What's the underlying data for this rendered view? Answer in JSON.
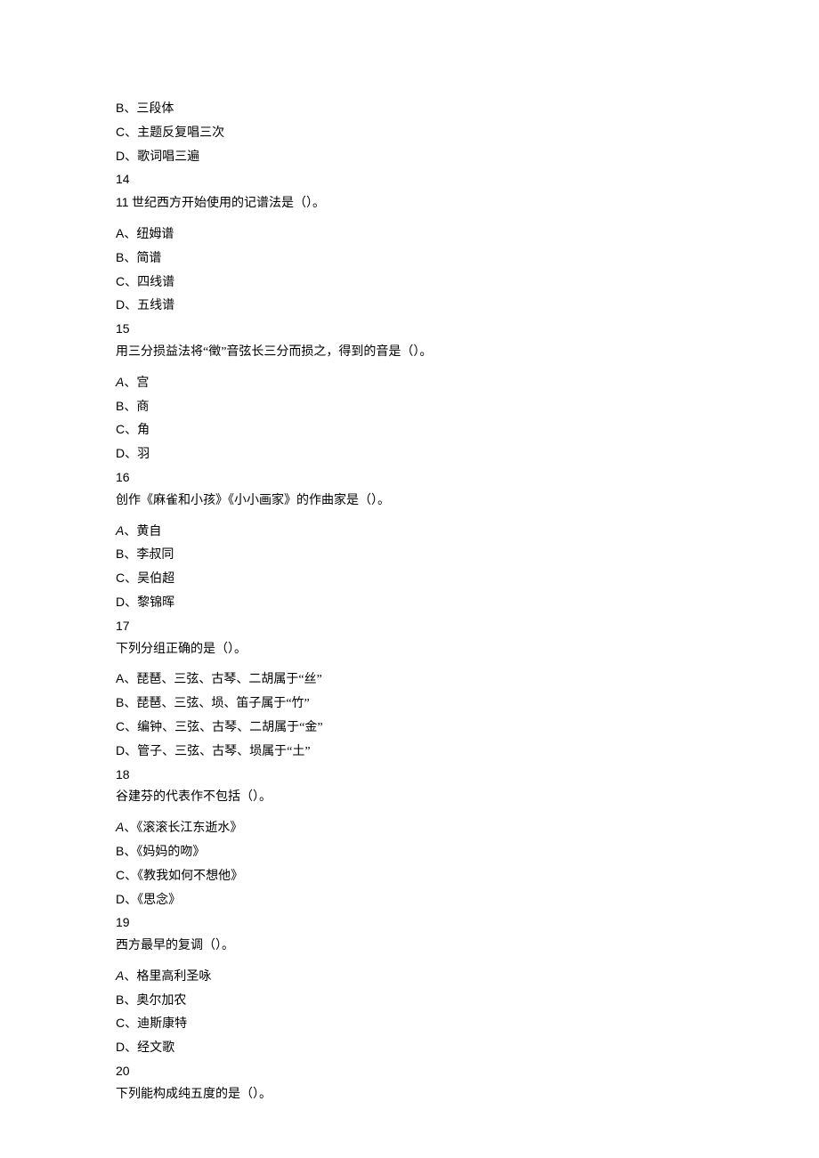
{
  "pre_options": [
    "B、三段体",
    "C、主题反复唱三次",
    "D、歌词唱三遍"
  ],
  "questions": [
    {
      "number": "14",
      "stem_prefix_latin": "11",
      "stem": "世纪西方开始使用的记谱法是（）。",
      "options": [
        {
          "label": "A",
          "text": "纽姆谱",
          "latin_label": true
        },
        {
          "label": "B",
          "text": "简谱",
          "latin_label": true
        },
        {
          "label": "C",
          "text": "四线谱",
          "latin_label": true
        },
        {
          "label": "D",
          "text": "五线谱",
          "latin_label": true
        }
      ]
    },
    {
      "number": "15",
      "stem": "用三分损益法将“徵”音弦长三分而损之，得到的音是（）。",
      "options": [
        {
          "label": "A",
          "text": "宫",
          "latin_label": true,
          "italic": true
        },
        {
          "label": "B",
          "text": "商",
          "latin_label": true
        },
        {
          "label": "C",
          "text": "角",
          "latin_label": true
        },
        {
          "label": "D",
          "text": "羽",
          "latin_label": true
        }
      ]
    },
    {
      "number": "16",
      "stem": "创作《麻雀和小孩》《小小画家》的作曲家是（）。",
      "options": [
        {
          "label": "A",
          "text": "黄自",
          "latin_label": true,
          "italic": true
        },
        {
          "label": "B",
          "text": "李叔同",
          "latin_label": true
        },
        {
          "label": "C",
          "text": "吴伯超",
          "latin_label": true
        },
        {
          "label": "D",
          "text": "黎锦晖",
          "latin_label": true
        }
      ]
    },
    {
      "number": "17",
      "stem": "下列分组正确的是（）。",
      "options": [
        {
          "label": "A",
          "text": "琵琶、三弦、古琴、二胡属于“丝”",
          "latin_label": true
        },
        {
          "label": "B",
          "text": "琵琶、三弦、埙、笛子属于“竹”",
          "latin_label": true
        },
        {
          "label": "C",
          "text": "编钟、三弦、古琴、二胡属于“金”",
          "latin_label": true
        },
        {
          "label": "D",
          "text": "管子、三弦、古琴、埙属于“土”",
          "latin_label": true
        }
      ]
    },
    {
      "number": "18",
      "stem": "谷建芬的代表作不包括（）。",
      "options": [
        {
          "label": "A",
          "text": "《滚滚长江东逝水》",
          "latin_label": true,
          "italic": true
        },
        {
          "label": "B",
          "text": "《妈妈的吻》",
          "latin_label": true
        },
        {
          "label": "C",
          "text": "《教我如何不想他》",
          "latin_label": true
        },
        {
          "label": "D",
          "text": "《思念》",
          "latin_label": true
        }
      ]
    },
    {
      "number": "19",
      "stem": "西方最早的复调（）。",
      "options": [
        {
          "label": "A",
          "text": "格里高利圣咏",
          "latin_label": true,
          "italic": true
        },
        {
          "label": "B",
          "text": "奥尔加农",
          "latin_label": true
        },
        {
          "label": "C",
          "text": "迪斯康特",
          "latin_label": true
        },
        {
          "label": "D",
          "text": "经文歌",
          "latin_label": true
        }
      ]
    },
    {
      "number": "20",
      "stem": "下列能构成纯五度的是（）。",
      "options": []
    }
  ]
}
